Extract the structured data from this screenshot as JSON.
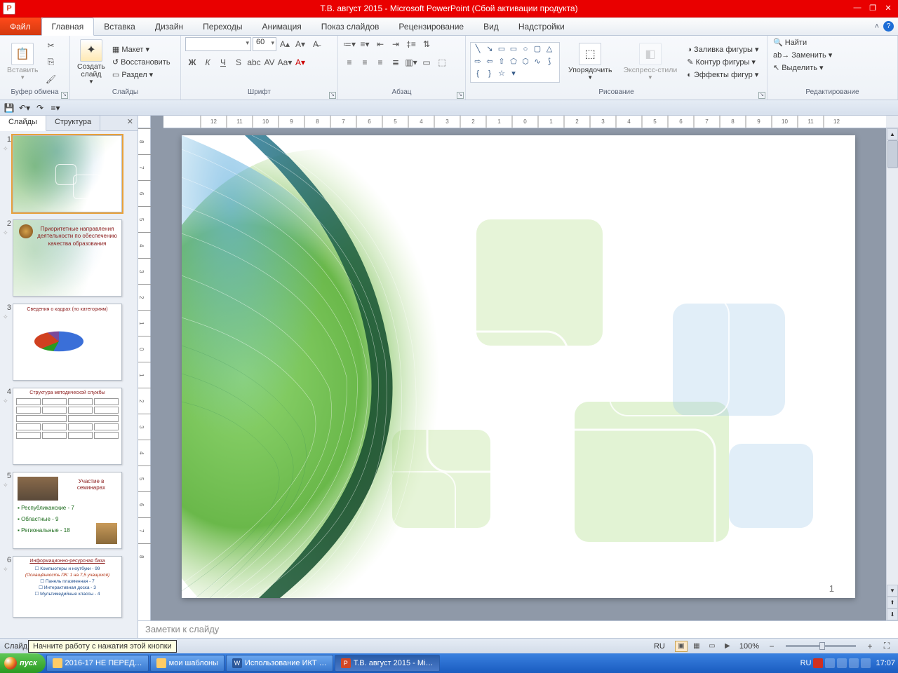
{
  "titlebar": {
    "app_icon_letter": "P",
    "title": "Т.В. август 2015  -  Microsoft PowerPoint (Сбой активации продукта)"
  },
  "menu": {
    "file": "Файл",
    "tabs": [
      "Главная",
      "Вставка",
      "Дизайн",
      "Переходы",
      "Анимация",
      "Показ слайдов",
      "Рецензирование",
      "Вид",
      "Надстройки"
    ],
    "active": 0
  },
  "ribbon": {
    "clipboard": {
      "label": "Буфер обмена",
      "paste": "Вставить"
    },
    "slides": {
      "label": "Слайды",
      "new": "Создать\nслайд",
      "layout": "Макет",
      "reset": "Восстановить",
      "section": "Раздел"
    },
    "font": {
      "label": "Шрифт",
      "size": "60",
      "name": ""
    },
    "paragraph": {
      "label": "Абзац"
    },
    "drawing": {
      "label": "Рисование",
      "arrange": "Упорядочить",
      "quick": "Экспресс-стили",
      "fill": "Заливка фигуры",
      "outline": "Контур фигуры",
      "effects": "Эффекты фигур"
    },
    "editing": {
      "label": "Редактирование",
      "find": "Найти",
      "replace": "Заменить",
      "select": "Выделить"
    }
  },
  "side": {
    "tab_slides": "Слайды",
    "tab_outline": "Структура",
    "slides": [
      {
        "n": "1"
      },
      {
        "n": "2",
        "title": "Приоритетные направления деятельности по обеспечению качества  образования"
      },
      {
        "n": "3",
        "title": "Сведения о кадрах (по категориям)"
      },
      {
        "n": "4",
        "title": "Структура методической службы"
      },
      {
        "n": "5",
        "title": "Участие в семинарах",
        "lines": [
          "Республиканские  -  7",
          "Областные  -  9",
          "Региональные  -  18"
        ]
      },
      {
        "n": "6",
        "title": "Информационно-ресурсная база",
        "lines": [
          "☐ Компьютеры и ноутбуки -  99",
          "(Оснащённость ПК:  1 на 7,5 учащихся)",
          "☐ Панель плазменная -  7",
          "☐ Интерактивная доска -  3",
          "☐ Мультимедийные классы -  4"
        ]
      }
    ]
  },
  "slide": {
    "page": "1"
  },
  "notes": {
    "placeholder": "Заметки к слайду"
  },
  "status": {
    "left": "Слайд",
    "tooltip": "Начните работу с нажатия этой кнопки",
    "lang": "RU",
    "zoom": "100%"
  },
  "ruler_ticks": [
    "12",
    "11",
    "10",
    "9",
    "8",
    "7",
    "6",
    "5",
    "4",
    "3",
    "2",
    "1",
    "0",
    "1",
    "2",
    "3",
    "4",
    "5",
    "6",
    "7",
    "8",
    "9",
    "10",
    "11",
    "12"
  ],
  "vruler_ticks": [
    "8",
    "7",
    "6",
    "5",
    "4",
    "3",
    "2",
    "1",
    "0",
    "1",
    "2",
    "3",
    "4",
    "5",
    "6",
    "7",
    "8"
  ],
  "taskbar": {
    "start": "пуск",
    "items": [
      {
        "label": "2016-17  НЕ ПЕРЕД…",
        "color": "#fc6"
      },
      {
        "label": "мои шаблоны",
        "color": "#fc6"
      },
      {
        "label": "Использование ИКТ …",
        "color": "#3a6fd8"
      },
      {
        "label": "Т.В. август 2015 - Mi…",
        "color": "#d24726",
        "active": true
      }
    ],
    "lang": "RU",
    "time": "17:07"
  }
}
